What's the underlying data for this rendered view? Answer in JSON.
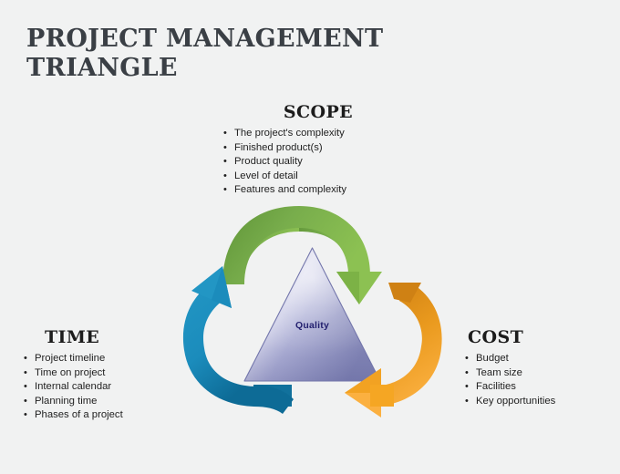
{
  "slide": {
    "background_color": "#f1f2f2",
    "title": "PROJECT MANAGEMENT\nTRIANGLE",
    "title_color": "#3a3f45"
  },
  "diagram": {
    "center_label": "Quality",
    "center_label_color": "#221f6e",
    "triangle": {
      "fill_light": "#c9cbe4",
      "fill_mid": "#a3a5cd",
      "fill_dark": "#8184b2",
      "edge": "#6f72a4"
    },
    "arrows": [
      {
        "name": "scope-to-cost-arrow",
        "position": "top",
        "color": "#72a84a",
        "color_dark": "#5d8f3a",
        "direction": "clockwise"
      },
      {
        "name": "time-to-scope-arrow",
        "position": "bottom-left",
        "color": "#1b8cbc",
        "color_dark": "#11719c",
        "direction": "clockwise"
      },
      {
        "name": "cost-to-time-arrow",
        "position": "bottom-right",
        "color": "#f5a623",
        "color_dark": "#d2861a",
        "direction": "clockwise"
      }
    ]
  },
  "corners": {
    "scope": {
      "heading": "SCOPE",
      "items": [
        "The project's complexity",
        "Finished product(s)",
        "Product quality",
        "Level of detail",
        "Features and complexity"
      ]
    },
    "time": {
      "heading": "TIME",
      "items": [
        "Project timeline",
        "Time on project",
        "Internal calendar",
        "Planning time",
        "Phases of a project"
      ]
    },
    "cost": {
      "heading": "COST",
      "items": [
        "Budget",
        "Team size",
        "Facilities",
        "Key opportunities"
      ]
    }
  },
  "bullet_glyph": "•"
}
